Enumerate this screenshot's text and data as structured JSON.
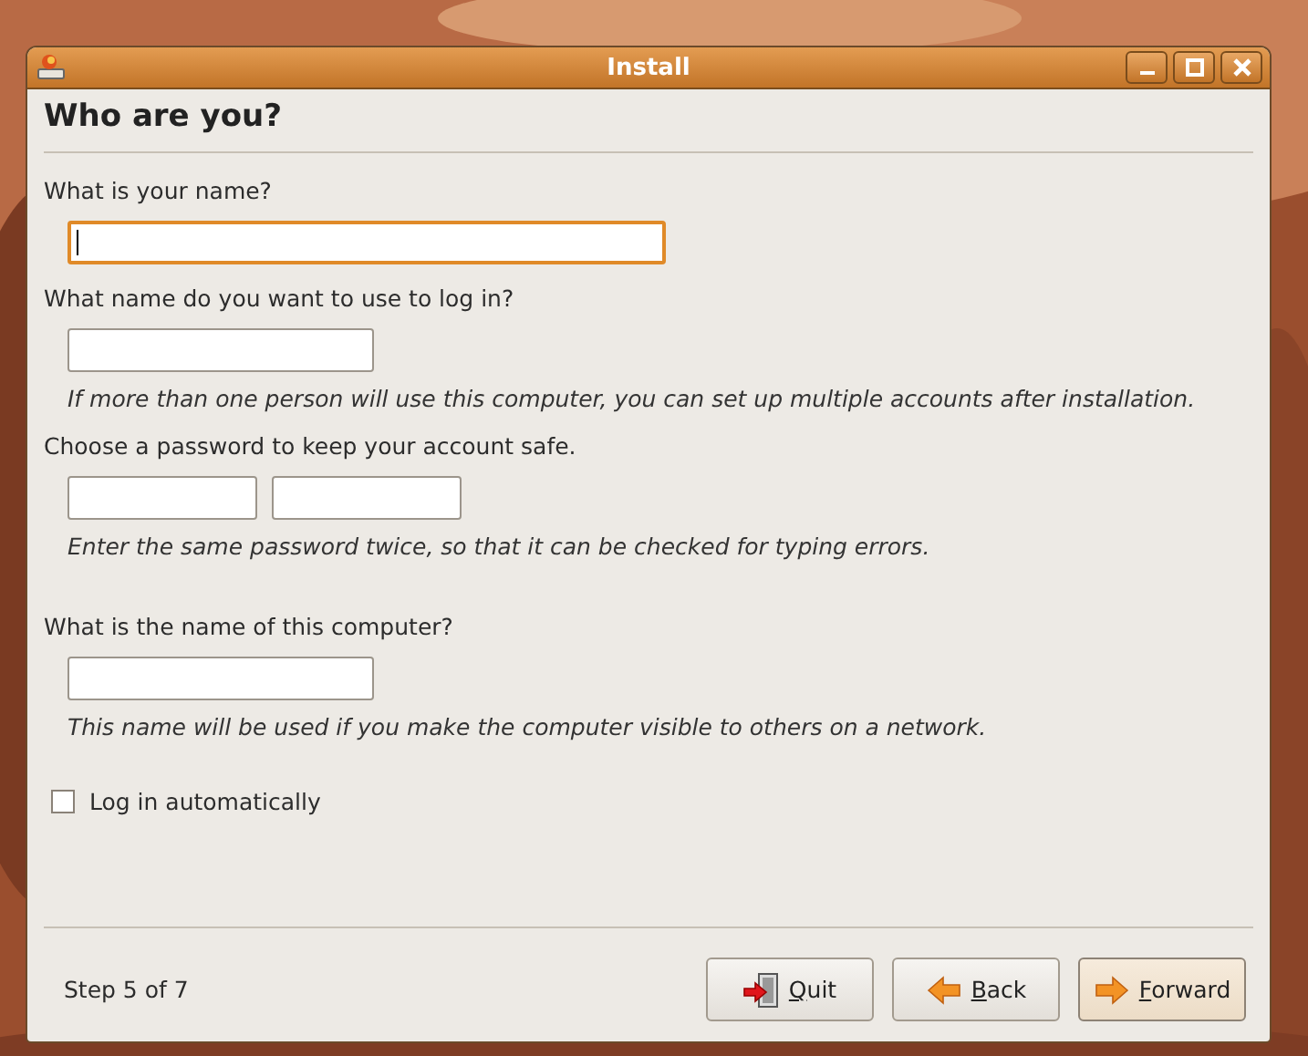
{
  "window": {
    "title": "Install"
  },
  "heading": "Who are you?",
  "questions": [
    {
      "label": "What is your name?",
      "fields": [
        {
          "kind": "wide",
          "focused": true
        }
      ]
    },
    {
      "label": "What name do you want to use to log in?",
      "fields": [
        {
          "kind": "medium",
          "focused": false
        }
      ],
      "hint": "If more than one person will use this computer, you can set up multiple accounts after installation."
    },
    {
      "label": "Choose a password to keep your account safe.",
      "fields": [
        {
          "kind": "short",
          "focused": false
        },
        {
          "kind": "short",
          "focused": false
        }
      ],
      "hint": "Enter the same password twice, so that it can be checked for typing errors."
    },
    {
      "label": "What is the name of this computer?",
      "fields": [
        {
          "kind": "medium",
          "focused": false
        }
      ],
      "hint": "This name will be used if you make the computer visible to others on a network."
    }
  ],
  "auto_login": {
    "label": "Log in automatically",
    "checked": false
  },
  "step": "Step 5 of 7",
  "buttons": [
    {
      "kind": "quit",
      "label": "Quit",
      "default": false
    },
    {
      "kind": "back",
      "label": "Back",
      "default": false
    },
    {
      "kind": "forward",
      "label": "Forward",
      "default": true
    }
  ]
}
